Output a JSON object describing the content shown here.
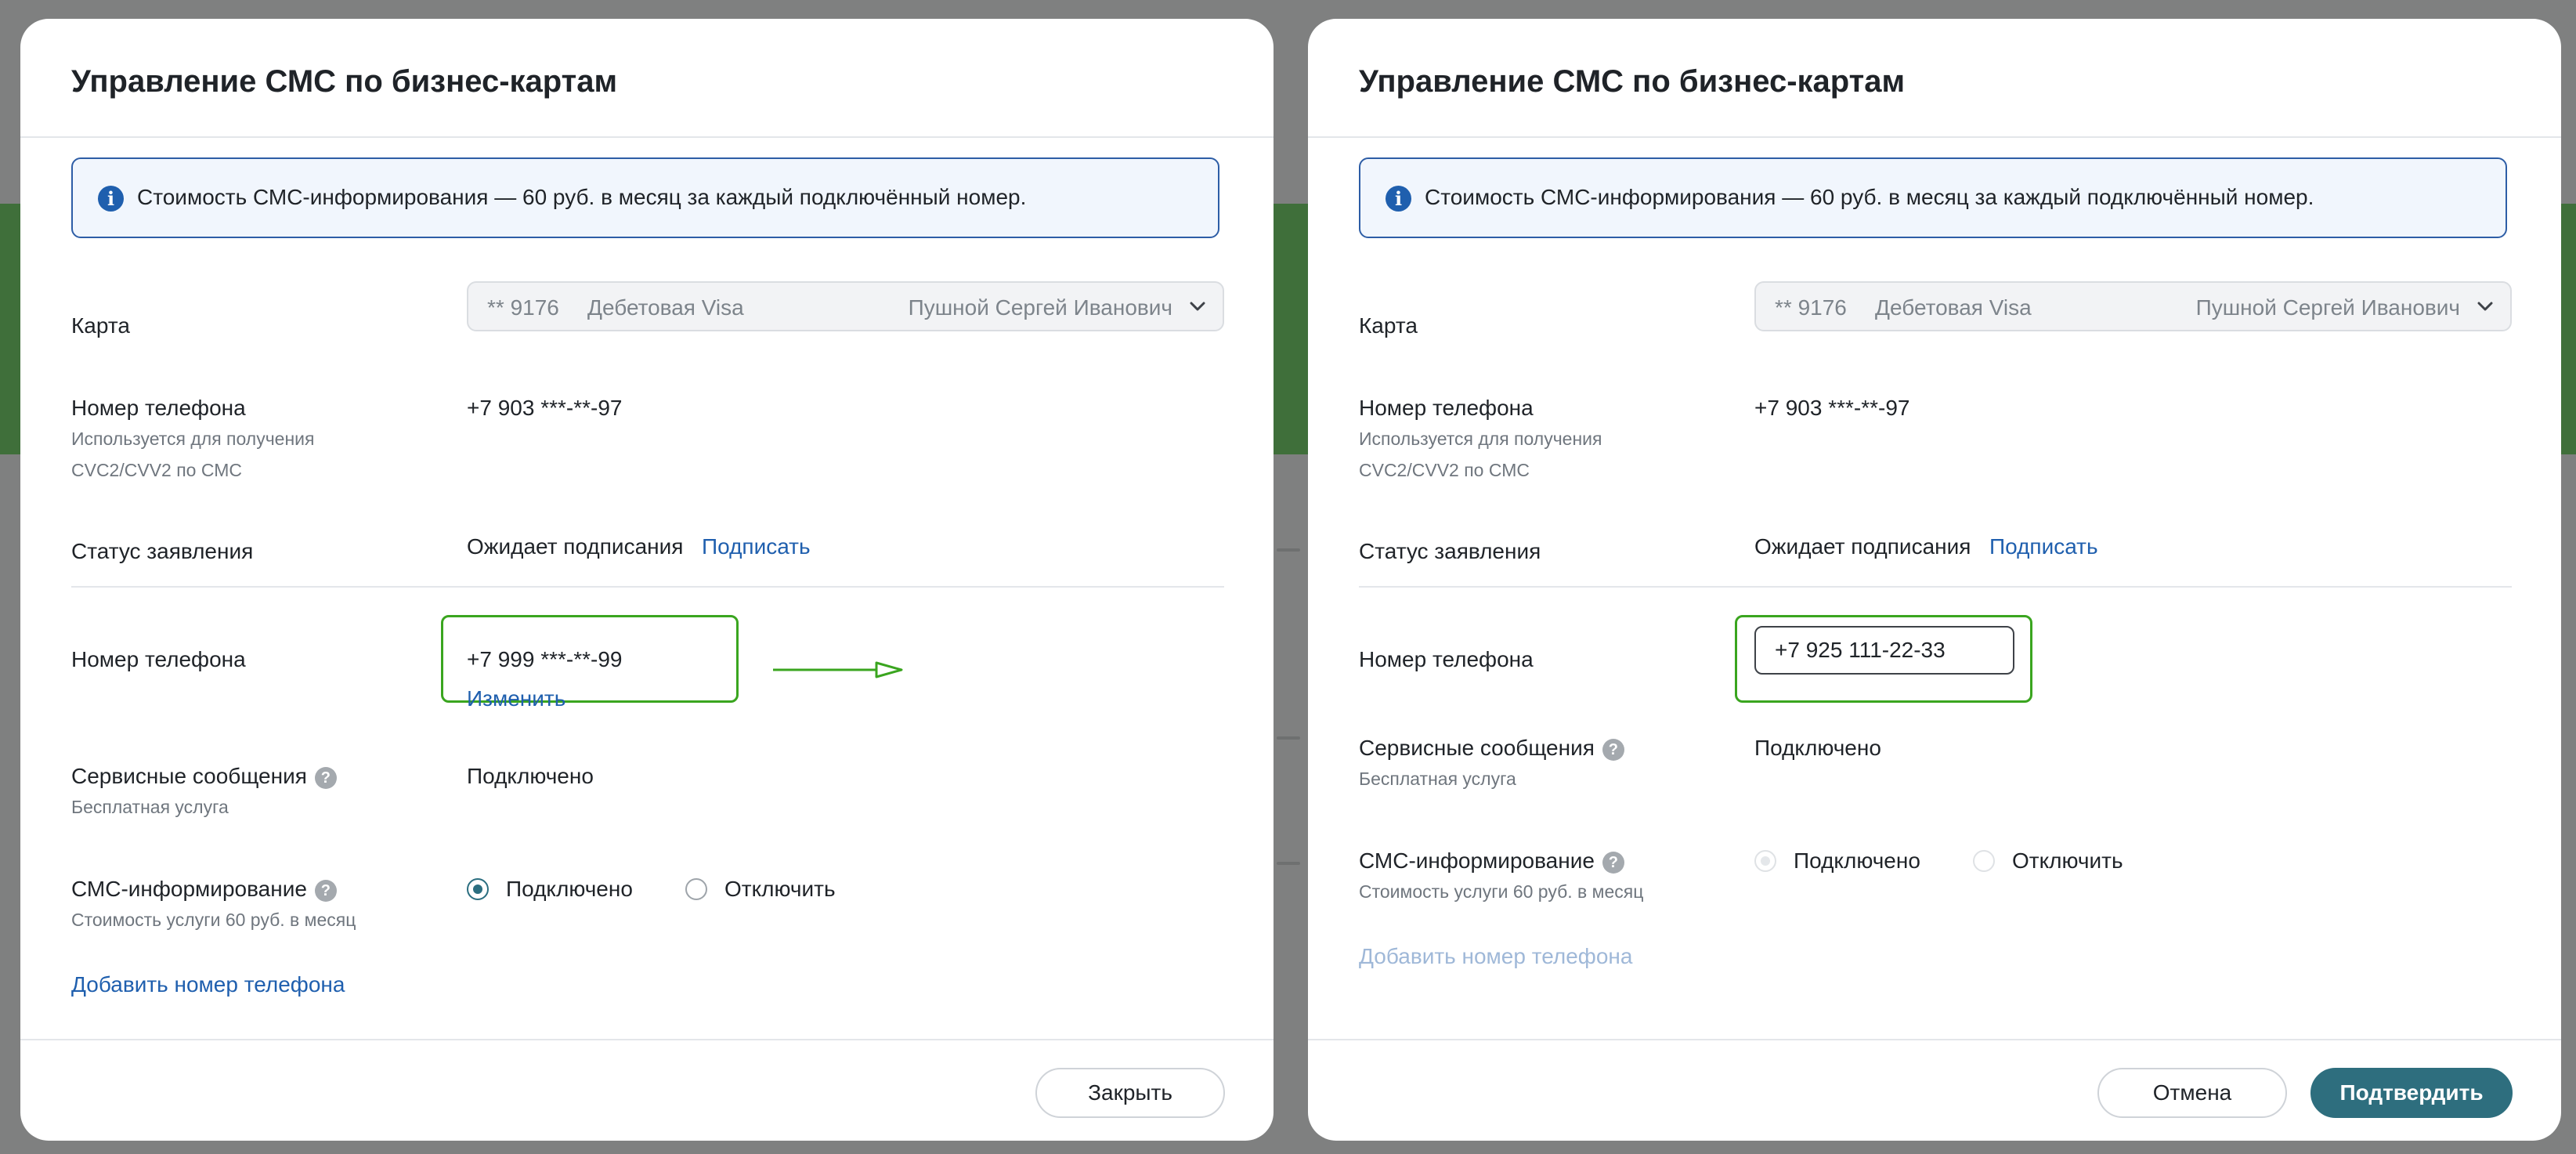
{
  "left_dialog": {
    "title": "Управление СМС по бизнес-картам",
    "banner_text": "Стоимость СМС-информирования — 60 руб. в месяц за каждый подключённый номер.",
    "card_label": "Карта",
    "card_select": {
      "number": "** 9176",
      "type": "Дебетовая Visa",
      "holder": "Пушной Сергей Иванович"
    },
    "primary_phone": {
      "label": "Номер телефона",
      "hint_line1": "Используется для получения",
      "hint_line2": "CVC2/CVV2 по СМС",
      "value": "+7 903 ***-**-97"
    },
    "status": {
      "label": "Статус заявления",
      "value": "Ожидает подписания",
      "action": "Подписать"
    },
    "phone": {
      "label": "Номер телефона",
      "value": "+7 999 ***-**-99",
      "action": "Изменить"
    },
    "service_messages": {
      "label": "Сервисные сообщения",
      "hint": "Бесплатная услуга",
      "value": "Подключено"
    },
    "sms_info": {
      "label": "СМС-информирование",
      "hint": "Стоимость услуги 60 руб. в месяц",
      "option_on": "Подключено",
      "option_off": "Отключить",
      "selected": "Подключено"
    },
    "add_phone": "Добавить номер телефона",
    "close_button": "Закрыть"
  },
  "right_dialog": {
    "title": "Управление СМС по бизнес-картам",
    "banner_text": "Стоимость СМС-информирования — 60 руб. в месяц за каждый подключённый номер.",
    "card_label": "Карта",
    "card_select": {
      "number": "** 9176",
      "type": "Дебетовая Visa",
      "holder": "Пушной Сергей Иванович"
    },
    "primary_phone": {
      "label": "Номер телефона",
      "hint_line1": "Используется для получения",
      "hint_line2": "CVC2/CVV2 по СМС",
      "value": "+7 903 ***-**-97"
    },
    "status": {
      "label": "Статус заявления",
      "value": "Ожидает подписания",
      "action": "Подписать"
    },
    "phone": {
      "label": "Номер телефона",
      "input_value": "+7 925 111-22-33"
    },
    "service_messages": {
      "label": "Сервисные сообщения",
      "hint": "Бесплатная услуга",
      "value": "Подключено"
    },
    "sms_info": {
      "label": "СМС-информирование",
      "hint": "Стоимость услуги 60 руб. в месяц",
      "option_on": "Подключено",
      "option_off": "Отключить",
      "selected": "Подключено",
      "disabled": true
    },
    "add_phone": "Добавить номер телефона",
    "cancel_button": "Отмена",
    "confirm_button": "Подтвердить"
  },
  "icons": {
    "info": "info-icon",
    "help": "question-icon",
    "dropdown": "chevron-down-icon",
    "arrow": "arrow-right-icon"
  },
  "colors": {
    "accent": "#2e6e7e",
    "link": "#1f5fae",
    "highlight": "#3aa51f",
    "banner_border": "#2d5da6"
  }
}
